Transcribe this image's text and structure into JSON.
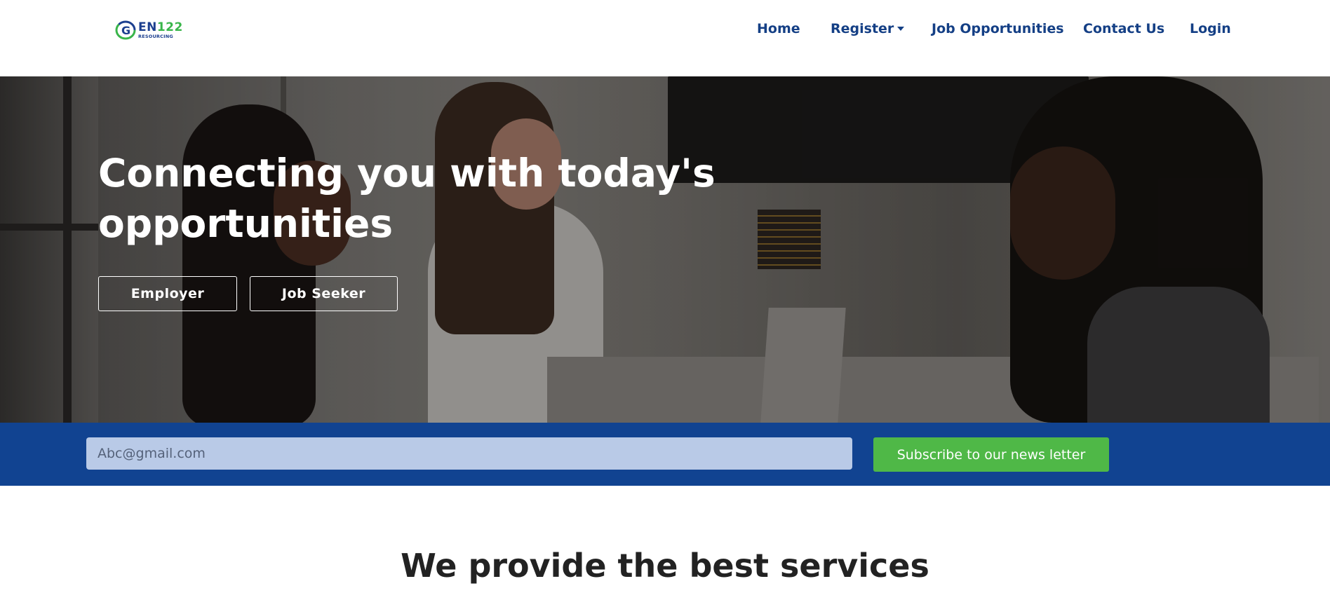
{
  "brand": {
    "logo_letter": "G",
    "logo_text": "EN",
    "logo_number": "122",
    "logo_subtext": "RESOURCING",
    "colors": {
      "primary": "#143f85",
      "accent": "#39b54a"
    }
  },
  "nav": {
    "items": [
      {
        "label": "Home"
      },
      {
        "label": "Register",
        "has_dropdown": true,
        "icon": "caret-down-icon"
      },
      {
        "label": "Job Opportunities"
      },
      {
        "label": "Contact Us"
      },
      {
        "label": "Login"
      }
    ]
  },
  "hero": {
    "title": "Connecting you with today's opportunities",
    "buttons": {
      "employer": "Employer",
      "job_seeker": "Job Seeker"
    }
  },
  "newsletter": {
    "email_placeholder": "Abc@gmail.com",
    "subscribe_label": "Subscribe to our news letter",
    "colors": {
      "band": "#114391",
      "button": "#4fb847",
      "input": "#b9cae7"
    }
  },
  "services": {
    "title": "We provide the best services"
  }
}
